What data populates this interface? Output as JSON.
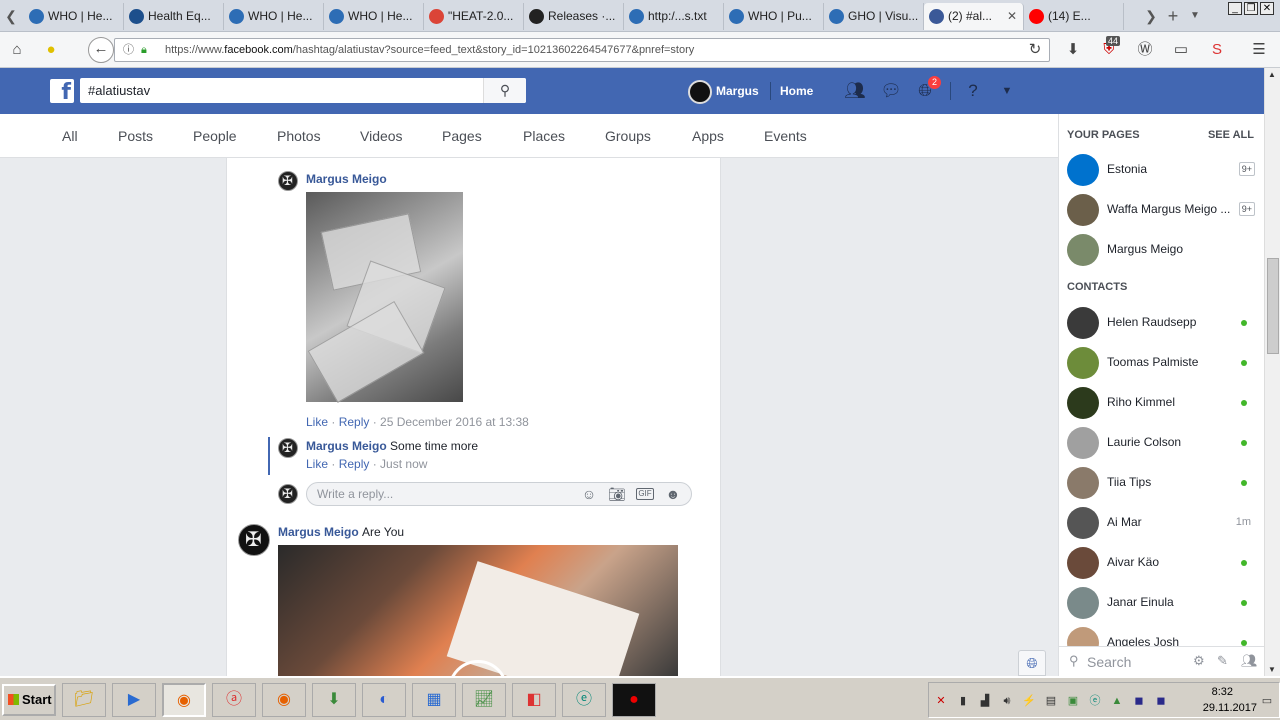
{
  "browser": {
    "tabs": [
      {
        "label": "WHO | He...",
        "color": "#2d6db5"
      },
      {
        "label": "Health Eq...",
        "color": "#1d4f8c"
      },
      {
        "label": "WHO | He...",
        "color": "#2d6db5"
      },
      {
        "label": "WHO | He...",
        "color": "#2d6db5"
      },
      {
        "label": "\"HEAT-2.0...",
        "color": "#db4437"
      },
      {
        "label": "Releases ·...",
        "color": "#222222"
      },
      {
        "label": "http:/...s.txt",
        "color": "#2d6db5"
      },
      {
        "label": "WHO | Pu...",
        "color": "#2d6db5"
      },
      {
        "label": "GHO | Visu...",
        "color": "#2d6db5"
      },
      {
        "label": "(2) #al...",
        "color": "#3b5998"
      },
      {
        "label": "(14) E...",
        "color": "#ff0000"
      }
    ],
    "tab_close": "✕",
    "new_tab": "+",
    "url_prefix": "https://www.",
    "url_domain": "facebook.com",
    "url_rest": "/hashtag/alatiustav?source=feed_text&story_id=10213602264547677&pnref=story",
    "addon_badge": "44"
  },
  "fb": {
    "search_value": "#alatiustav",
    "user_name": "Margus",
    "home": "Home",
    "notif_count": "2",
    "filters": [
      "All",
      "Posts",
      "People",
      "Photos",
      "Videos",
      "Pages",
      "Places",
      "Groups",
      "Apps",
      "Events"
    ]
  },
  "feed": {
    "comment1": {
      "author": "Margus Meigo",
      "like": "Like",
      "reply": "Reply",
      "time": "25 December 2016 at 13:38"
    },
    "comment2": {
      "author": "Margus Meigo",
      "text": "Some time more",
      "like": "Like",
      "reply": "Reply",
      "time": "Just now"
    },
    "reply_placeholder": "Write a reply...",
    "post": {
      "author": "Margus Meigo",
      "text": "Are You"
    }
  },
  "sidebar": {
    "your_pages_title": "YOUR PAGES",
    "see_all": "SEE ALL",
    "pages": [
      {
        "name": "Estonia",
        "count": "9+",
        "color": "#0072ce"
      },
      {
        "name": "Waffa Margus Meigo ...",
        "count": "9+",
        "color": "#6b5f4a"
      },
      {
        "name": "Margus Meigo",
        "count": "",
        "color": "#7a8a6a"
      }
    ],
    "contacts_title": "CONTACTS",
    "contacts": [
      {
        "name": "Helen Raudsepp",
        "status": "online",
        "color": "#3a3a3a"
      },
      {
        "name": "Toomas Palmiste",
        "status": "online",
        "color": "#6d8c3a"
      },
      {
        "name": "Riho Kimmel",
        "status": "online",
        "color": "#2c3a1c"
      },
      {
        "name": "Laurie Colson",
        "status": "online",
        "color": "#a0a0a0"
      },
      {
        "name": "Tiia Tips",
        "status": "online",
        "color": "#8a7a6a"
      },
      {
        "name": "Ai Mar",
        "status": "1m",
        "color": "#555555"
      },
      {
        "name": "Aivar Käo",
        "status": "online",
        "color": "#6a4a3a"
      },
      {
        "name": "Janar Einula",
        "status": "online",
        "color": "#7a8a8a"
      },
      {
        "name": "Angeles Josh",
        "status": "online",
        "color": "#c09a7a"
      }
    ],
    "search_placeholder": "Search"
  },
  "taskbar": {
    "start": "Start",
    "time": "8:32",
    "date": "29.11.2017"
  }
}
